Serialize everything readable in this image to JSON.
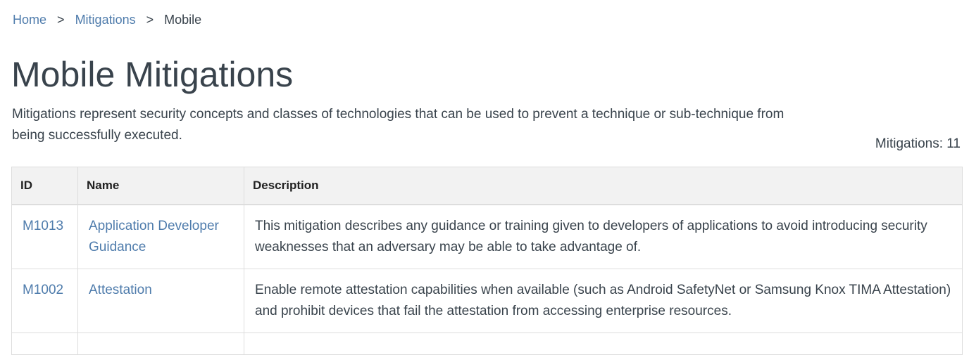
{
  "breadcrumb": {
    "items": [
      "Home",
      "Mitigations"
    ],
    "separator": ">",
    "current": "Mobile"
  },
  "page": {
    "title": "Mobile Mitigations",
    "description": "Mitigations represent security concepts and classes of technologies that can be used to prevent a technique or sub-technique from being successfully executed.",
    "count_label": "Mitigations: 11"
  },
  "table": {
    "headers": [
      "ID",
      "Name",
      "Description"
    ],
    "rows": [
      {
        "id": "M1013",
        "name": "Application Developer Guidance",
        "description": "This mitigation describes any guidance or training given to developers of applications to avoid introducing security weaknesses that an adversary may be able to take advantage of."
      },
      {
        "id": "M1002",
        "name": "Attestation",
        "description": "Enable remote attestation capabilities when available (such as Android SafetyNet or Samsung Knox TIMA Attestation) and prohibit devices that fail the attestation from accessing enterprise resources."
      },
      {
        "id": "",
        "name": "",
        "description": ""
      }
    ]
  },
  "colors": {
    "link": "#4f7cac",
    "text": "#39434c",
    "header_bg": "#f2f2f2",
    "border": "#dddddd"
  }
}
